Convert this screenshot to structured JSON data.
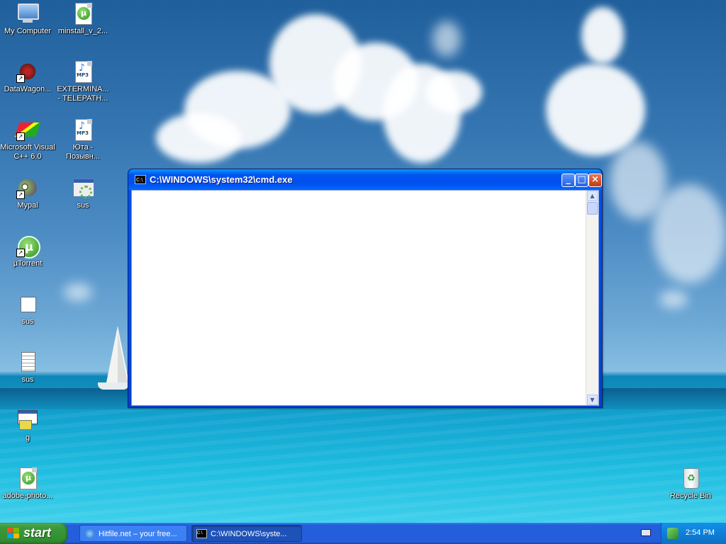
{
  "desktop": {
    "icons": [
      {
        "label": "My Computer",
        "icon": "my-computer-icon"
      },
      {
        "label": "minstall_v_2...",
        "icon": "utorrent-file-icon"
      },
      {
        "label": "DataWagon...",
        "icon": "datawagon-shortcut-icon"
      },
      {
        "label": "EXTERMINA...\n- TELEPATH...",
        "icon": "mp3-file-icon"
      },
      {
        "label": "Microsoft Visual\nC++ 6.0",
        "icon": "visual-cpp-shortcut-icon"
      },
      {
        "label": "Юта -\nПозывн...",
        "icon": "mp3-file-icon"
      },
      {
        "label": "Mypal",
        "icon": "mypal-shortcut-icon"
      },
      {
        "label": "sus",
        "icon": "application-icon"
      },
      {
        "label": "µTorrent",
        "icon": "utorrent-shortcut-icon"
      },
      {
        "label": "sus",
        "icon": "blank-file-icon"
      },
      {
        "label": "sus",
        "icon": "text-file-icon"
      },
      {
        "label": "g",
        "icon": "setup-file-icon"
      },
      {
        "label": "adobe-photo...",
        "icon": "utorrent-file-icon"
      },
      {
        "label": "Recycle Bin",
        "icon": "recycle-bin-icon"
      }
    ]
  },
  "window": {
    "title": "C:\\WINDOWS\\system32\\cmd.exe",
    "icon_text": "C:\\",
    "buttons": {
      "minimize": "_",
      "maximize": "□",
      "close": "×"
    },
    "scroll_up": "▲",
    "scroll_down": "▼"
  },
  "taskbar": {
    "start_label": "start",
    "tasks": [
      {
        "label": "Hitfile.net – your free...",
        "icon": "internet-explorer-icon",
        "active": false
      },
      {
        "label": "C:\\WINDOWS\\syste...",
        "icon": "cmd-icon",
        "active": true
      }
    ],
    "clock": "2:54 PM"
  },
  "colors": {
    "titlebar_blue": "#0053ee",
    "start_green": "#3c9a3c",
    "taskbar_blue": "#245edb",
    "close_red": "#c33a12"
  }
}
